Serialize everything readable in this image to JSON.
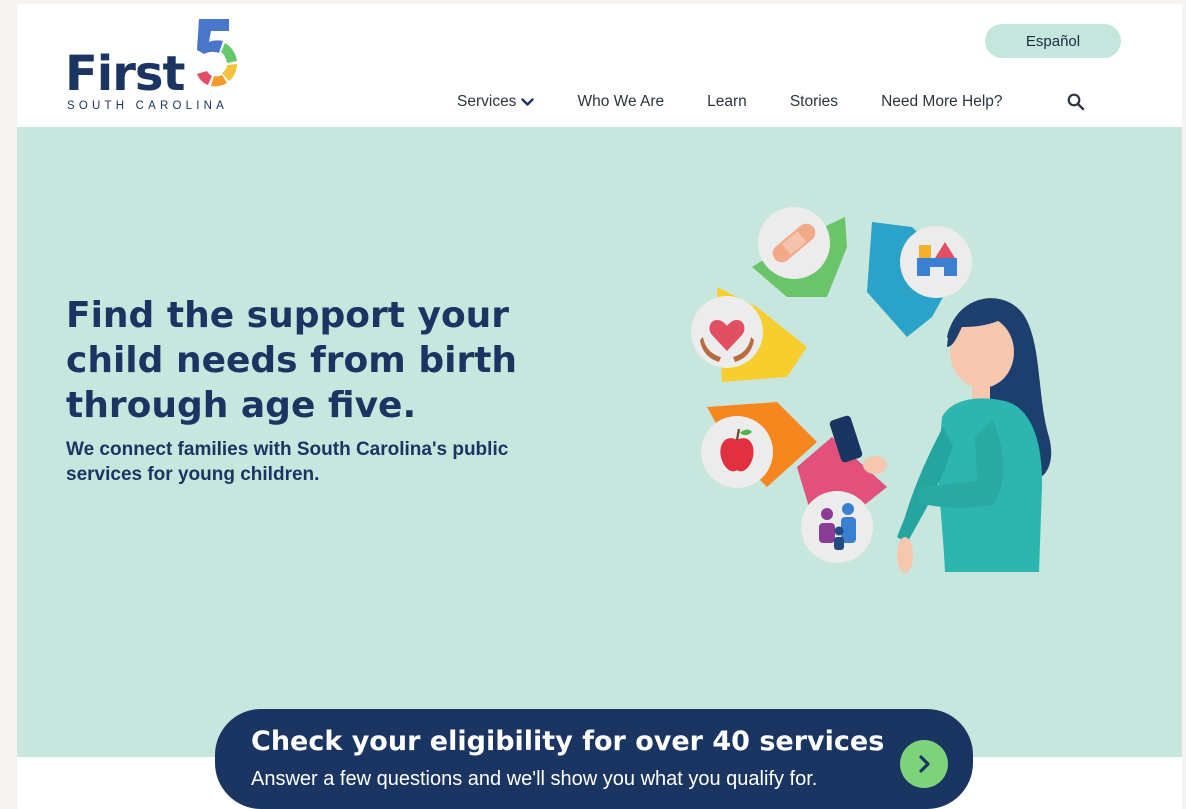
{
  "logo": {
    "brand": "First",
    "number": "5",
    "subtitle": "SOUTH CAROLINA"
  },
  "header": {
    "language_button": "Español",
    "nav": [
      {
        "label": "Services",
        "icon": "chevron-down-icon"
      },
      {
        "label": "Who We Are"
      },
      {
        "label": "Learn"
      },
      {
        "label": "Stories"
      },
      {
        "label": "Need More Help?"
      }
    ],
    "search_icon": "search-icon"
  },
  "hero": {
    "title": "Find the support your child needs from birth through age five.",
    "subtitle": "We connect families with South Carolina's public services for young children."
  },
  "cta": {
    "title": "Check your eligibility for over 40 services",
    "subtitle": "Answer a few questions and we'll show you what you qualify for.",
    "icon": "chevron-right-icon"
  },
  "colors": {
    "navy": "#1b3563",
    "hero_bg": "#c7e6de",
    "language_button_bg": "#c4e6dc",
    "cta_arrow": "#7cd37a"
  }
}
